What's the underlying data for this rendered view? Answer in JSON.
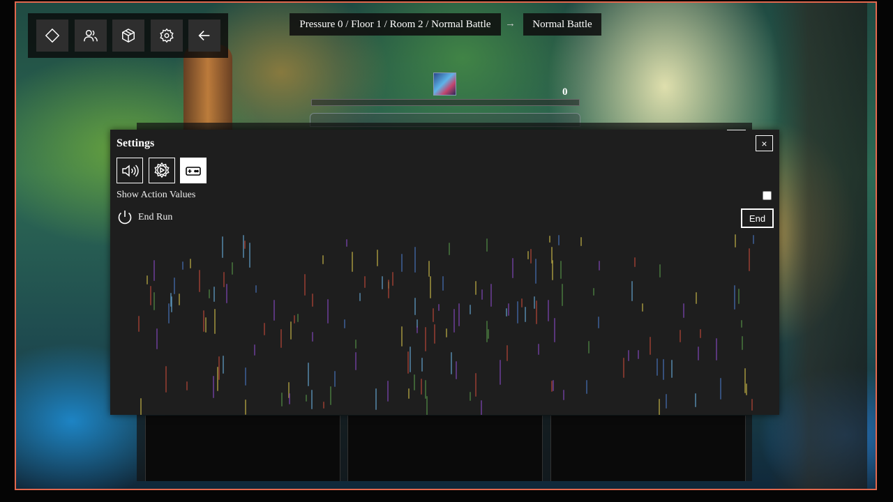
{
  "toolbar": {
    "buttons": [
      {
        "icon": "diamond-icon"
      },
      {
        "icon": "users-icon"
      },
      {
        "icon": "cube-icon"
      },
      {
        "icon": "gear-icon"
      },
      {
        "icon": "arrow-left-icon"
      }
    ]
  },
  "breadcrumb": {
    "path": "Pressure 0 / Floor 1 / Room 2 / Normal Battle",
    "arrow": "→",
    "current": "Normal Battle"
  },
  "battle": {
    "counter": "0"
  },
  "settings": {
    "title": "Settings",
    "close_label": "×",
    "tabs": [
      {
        "icon": "audio-icon",
        "active": false
      },
      {
        "icon": "system-gear-icon",
        "active": false
      },
      {
        "icon": "gamepad-icon",
        "active": true
      }
    ],
    "show_action_values_label": "Show Action Values",
    "show_action_values_checked": false,
    "end_run_label": "End Run",
    "end_button_label": "End"
  },
  "colors": {
    "frame_border": "#e3684e",
    "panel_bg": "#1e1e1e",
    "toolbar_button_bg": "#2e2e2e",
    "text": "#ffffff"
  }
}
